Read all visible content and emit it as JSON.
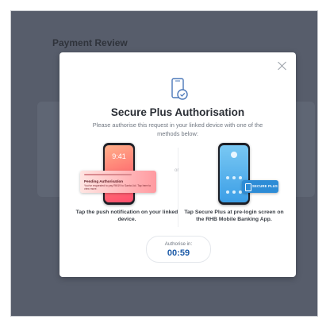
{
  "page": {
    "title": "Payment Review"
  },
  "modal": {
    "title": "Secure Plus Authorisation",
    "subtitle": "Please authorise this request in your linked device with one of the methods below:",
    "or_label": "or",
    "methods": [
      {
        "caption": "Tap the push notification on your linked device.",
        "phone_time": "9:41",
        "notification_title": "Pending Authorisation",
        "notification_text": "You've requested to pay RM19 to Santa Ltd. Tap here to view more."
      },
      {
        "caption": "Tap Secure Plus at pre-login screen on the RHB Mobile Banking App.",
        "chip_label": "SECURE PLUS"
      }
    ],
    "timer": {
      "label": "Authorise in:",
      "value": "00:59"
    }
  },
  "colors": {
    "backdrop": "#575d6b",
    "accent_blue": "#1d5ba8",
    "chip_blue": "#2d8cd6"
  },
  "icons": {
    "close": "close-icon",
    "device": "secure-device-icon"
  }
}
